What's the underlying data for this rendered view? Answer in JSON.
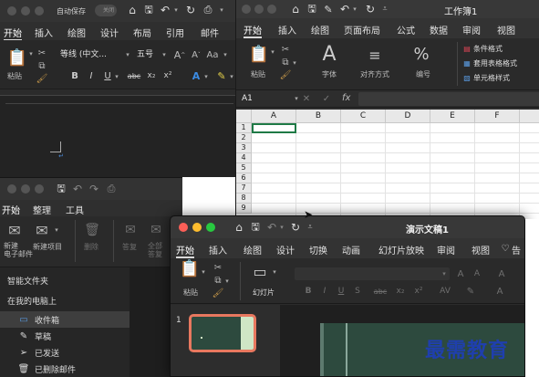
{
  "word": {
    "autosave_label": "自动保存",
    "autosave_state": "关闭",
    "tabs": [
      "开始",
      "插入",
      "绘图",
      "设计",
      "布局",
      "引用",
      "邮件"
    ],
    "paste_label": "粘贴",
    "font_name": "等线 (中文...",
    "font_size": "五号",
    "format_buttons": [
      "B",
      "I",
      "U",
      "abc",
      "x₂",
      "x²"
    ]
  },
  "excel": {
    "title": "工作簿1",
    "tabs": [
      "开始",
      "插入",
      "绘图",
      "页面布局",
      "公式",
      "数据",
      "审阅",
      "视图"
    ],
    "paste_label": "粘贴",
    "font_label": "字体",
    "align_label": "对齐方式",
    "number_label": "编号",
    "number_icon": "%",
    "styles": [
      "条件格式",
      "套用表格格式",
      "单元格样式"
    ],
    "name_box": "A1",
    "fx": "fx",
    "columns": [
      "A",
      "B",
      "C",
      "D",
      "E",
      "F"
    ],
    "rows": [
      "1",
      "2",
      "3",
      "4",
      "5",
      "6",
      "7",
      "8",
      "9"
    ]
  },
  "outlook": {
    "tabs": [
      "开始",
      "整理",
      "工具"
    ],
    "new_email_label": "新建\n电子邮件",
    "new_item_label": "新建项目",
    "delete_label": "删除",
    "reply_label": "答复",
    "reply_all_label": "全部\n答复",
    "smart_folders": "智能文件夹",
    "on_my_computer": "在我的电脑上",
    "folders": [
      {
        "icon": "inbox-icon",
        "label": "收件箱"
      },
      {
        "icon": "draft-icon",
        "label": "草稿"
      },
      {
        "icon": "send-icon",
        "label": "已发送"
      },
      {
        "icon": "trash-icon",
        "label": "已删除邮件"
      }
    ]
  },
  "ppt": {
    "title": "演示文稿1",
    "tabs": [
      "开始",
      "插入",
      "绘图",
      "设计",
      "切换",
      "动画",
      "幻灯片放映",
      "审阅",
      "视图",
      "告"
    ],
    "paste_label": "粘贴",
    "slide_label": "幻灯片",
    "slide_number": "1"
  },
  "watermark": "最需教育",
  "colors": {
    "close": "#fc5f57",
    "minimize": "#fdbc2e",
    "zoom": "#28c840",
    "watermark": "#1f3fae",
    "thumb_border": "#e8785f",
    "slide_green": "#2d4a3e"
  }
}
